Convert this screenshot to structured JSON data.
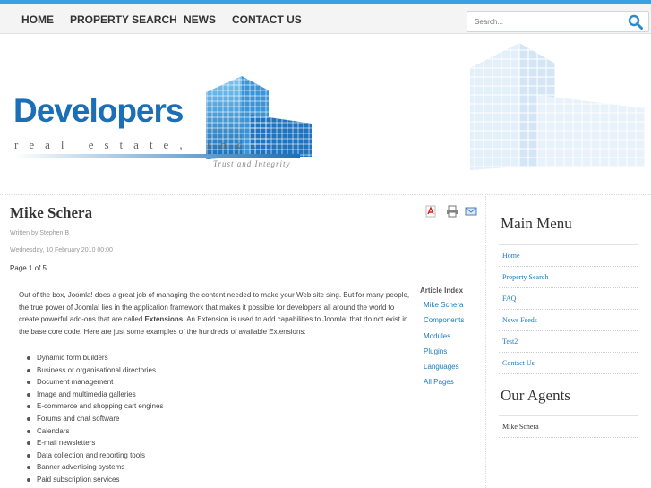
{
  "nav": {
    "items": [
      "HOME",
      "PROPERTY SEARCH",
      "NEWS",
      "CONTACT US"
    ],
    "search_placeholder": "Search..."
  },
  "banner": {
    "logo_title": "Developers",
    "logo_subtitle": "real estate, inc.",
    "tagline": "Trust and Integrity"
  },
  "article": {
    "title": "Mike Schera",
    "written_by": "Written by Stephen B",
    "date": "Wednesday, 10 February 2010 00:00",
    "page_info": "Page 1 of 5",
    "intro_before": "Out of the box, Joomla! does a great job of managing the content needed to make your Web site sing. But for many people, the true power of Joomla! lies in the application framework that makes it possible for developers all around the world to create powerful add-ons that are called ",
    "intro_bold": "Extensions",
    "intro_after": ". An Extension is used to add capabilities to Joomla! that do not exist in the base core code. Here are just some examples of the hundreds of available Extensions:",
    "bullets": [
      "Dynamic form builders",
      "Business or organisational directories",
      "Document management",
      "Image and multimedia galleries",
      "E-commerce and shopping cart engines",
      "Forums and chat software",
      "Calendars",
      "E-mail newsletters",
      "Data collection and reporting tools",
      "Banner advertising systems",
      "Paid subscription services"
    ],
    "index_title": "Article Index",
    "index_items": [
      "Mike Schera",
      "Components",
      "Modules",
      "Plugins",
      "Languages",
      "All Pages"
    ]
  },
  "icons": [
    "pdf-icon",
    "print-icon",
    "email-icon"
  ],
  "sidebar": {
    "menu_title": "Main Menu",
    "menu_items": [
      "Home",
      "Property Search",
      "FAQ",
      "News Feeds",
      "Test2",
      "Contact Us"
    ],
    "agents_title": "Our Agents",
    "agents": [
      "Mike Schera"
    ]
  },
  "colors": {
    "accent": "#3aa0e0",
    "link": "#1a7cc0",
    "logo": "#1a6fb6"
  }
}
